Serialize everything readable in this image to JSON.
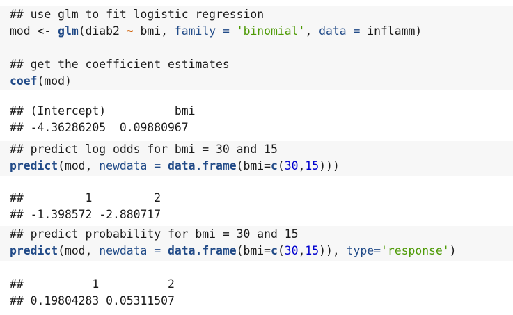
{
  "chunk1": {
    "comment1": "## use glm to fit logistic regression",
    "l2_var": "mod",
    "l2_assign": " <- ",
    "l2_fn": "glm",
    "l2_open": "(diab2 ",
    "l2_tilde": "~",
    "l2_bmi": " bmi, ",
    "l2_family": "family",
    "l2_eq1": " = ",
    "l2_binomial": "'binomial'",
    "l2_comma": ", ",
    "l2_data": "data",
    "l2_eq2": " = ",
    "l2_inflamm": "inflamm)",
    "comment2": "## get the coefficient estimates",
    "l4_fn": "coef",
    "l4_rest": "(mod)"
  },
  "output1": {
    "line1": "## (Intercept)          bmi",
    "line2": "## -4.36286205  0.09880967"
  },
  "chunk2": {
    "comment": "## predict log odds for bmi = 30 and 15",
    "fn": "predict",
    "open": "(mod, ",
    "newdata": "newdata",
    "eq": " = ",
    "df_fn": "data.frame",
    "p1": "(bmi=",
    "c_fn": "c",
    "p2": "(",
    "n30": "30",
    "comma": ",",
    "n15": "15",
    "close": ")))"
  },
  "output2": {
    "line1": "##         1         2",
    "line2": "## -1.398572 -2.880717"
  },
  "chunk3": {
    "comment": "## predict probability for bmi = 30 and 15",
    "fn": "predict",
    "open": "(mod, ",
    "newdata": "newdata",
    "eq": " = ",
    "df_fn": "data.frame",
    "p1": "(bmi=",
    "c_fn": "c",
    "p2": "(",
    "n30": "30",
    "comma": ",",
    "n15": "15",
    "close2": ")), ",
    "type": "type",
    "eq2": "=",
    "resp": "'response'",
    "close3": ")"
  },
  "output3": {
    "line1": "##          1          2",
    "line2": "## 0.19804283 0.05311507"
  }
}
